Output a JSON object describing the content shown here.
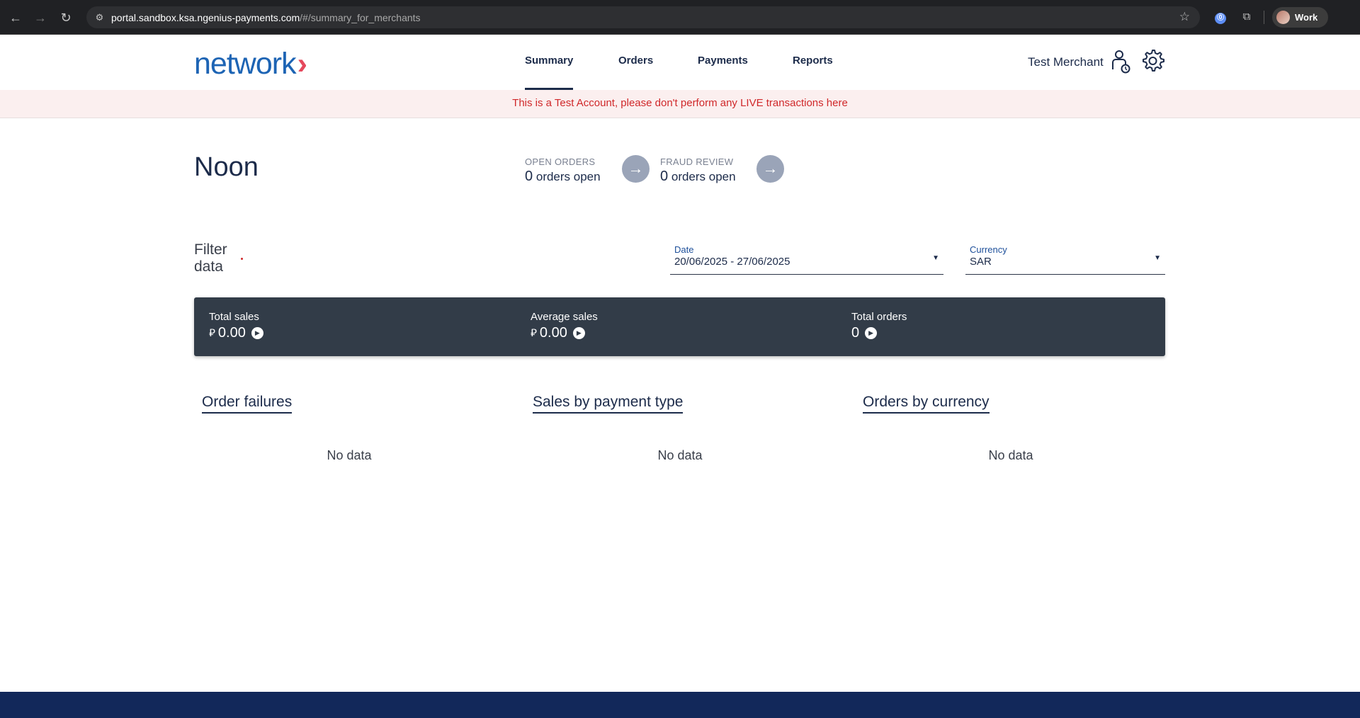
{
  "browser": {
    "url_host": "portal.sandbox.ksa.ngenius-payments.com",
    "url_path": "/#/summary_for_merchants",
    "profile_name": "Work",
    "icons": [
      "back-icon",
      "forward-icon",
      "reload-icon",
      "site-info-icon",
      "star-icon",
      "password-manager-icon",
      "extensions-icon"
    ]
  },
  "header": {
    "logo_text": "network",
    "logo_chevron": "›",
    "tabs": [
      {
        "label": "Summary",
        "active": true
      },
      {
        "label": "Orders",
        "active": false
      },
      {
        "label": "Payments",
        "active": false
      },
      {
        "label": "Reports",
        "active": false
      }
    ],
    "merchant_label": "Test Merchant",
    "accent_color": "#1d64b4",
    "logo_chevron_color": "#e5485c"
  },
  "banner": {
    "text": "This is a Test Account, please don't perform any LIVE transactions here",
    "color": "#d0282a"
  },
  "summary": {
    "merchant_name": "Noon",
    "open_orders": {
      "label": "OPEN ORDERS",
      "count": "0",
      "suffix": "orders open"
    },
    "fraud_review": {
      "label": "FRAUD REVIEW",
      "count": "0",
      "suffix": "orders open"
    }
  },
  "filter": {
    "label_line1": "Filter",
    "label_line2": "data",
    "date": {
      "label": "Date",
      "value": "20/06/2025 - 27/06/2025"
    },
    "currency": {
      "label": "Currency",
      "value": "SAR"
    }
  },
  "stats": {
    "currency_symbol": "⃁",
    "total_sales": {
      "label": "Total sales",
      "value": "0.00"
    },
    "average_sales": {
      "label": "Average sales",
      "value": "0.00"
    },
    "total_orders": {
      "label": "Total orders",
      "value": "0"
    }
  },
  "panels": [
    {
      "title": "Order failures",
      "empty_text": "No data"
    },
    {
      "title": "Sales by payment type",
      "empty_text": "No data"
    },
    {
      "title": "Orders by currency",
      "empty_text": "No data"
    }
  ]
}
